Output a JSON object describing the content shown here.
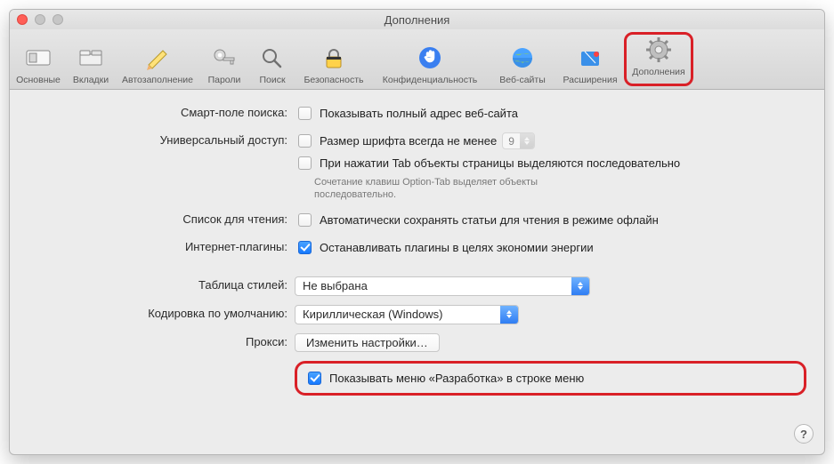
{
  "window": {
    "title": "Дополнения"
  },
  "toolbar": {
    "items": [
      {
        "label": "Основные"
      },
      {
        "label": "Вкладки"
      },
      {
        "label": "Автозаполнение"
      },
      {
        "label": "Пароли"
      },
      {
        "label": "Поиск"
      },
      {
        "label": "Безопасность"
      },
      {
        "label": "Конфиденциальность"
      },
      {
        "label": "Веб-сайты"
      },
      {
        "label": "Расширения"
      },
      {
        "label": "Дополнения"
      }
    ]
  },
  "sections": {
    "smart_search": {
      "label": "Смарт-поле поиска:",
      "checkbox_label": "Показывать полный адрес веб-сайта"
    },
    "accessibility": {
      "label": "Универсальный доступ:",
      "font_checkbox_label": "Размер шрифта всегда не менее",
      "font_size": "9",
      "tab_checkbox_label": "При нажатии Tab объекты страницы выделяются последовательно",
      "hint": "Сочетание клавиш Option-Tab выделяет объекты последовательно."
    },
    "reading_list": {
      "label": "Список для чтения:",
      "checkbox_label": "Автоматически сохранять статьи для чтения в режиме офлайн"
    },
    "plugins": {
      "label": "Интернет-плагины:",
      "checkbox_label": "Останавливать плагины в целях экономии энергии"
    },
    "stylesheet": {
      "label": "Таблица стилей:",
      "value": "Не выбрана"
    },
    "encoding": {
      "label": "Кодировка по умолчанию:",
      "value": "Кириллическая (Windows)"
    },
    "proxy": {
      "label": "Прокси:",
      "button": "Изменить настройки…"
    },
    "develop": {
      "checkbox_label": "Показывать меню «Разработка» в строке меню"
    }
  },
  "help": "?"
}
